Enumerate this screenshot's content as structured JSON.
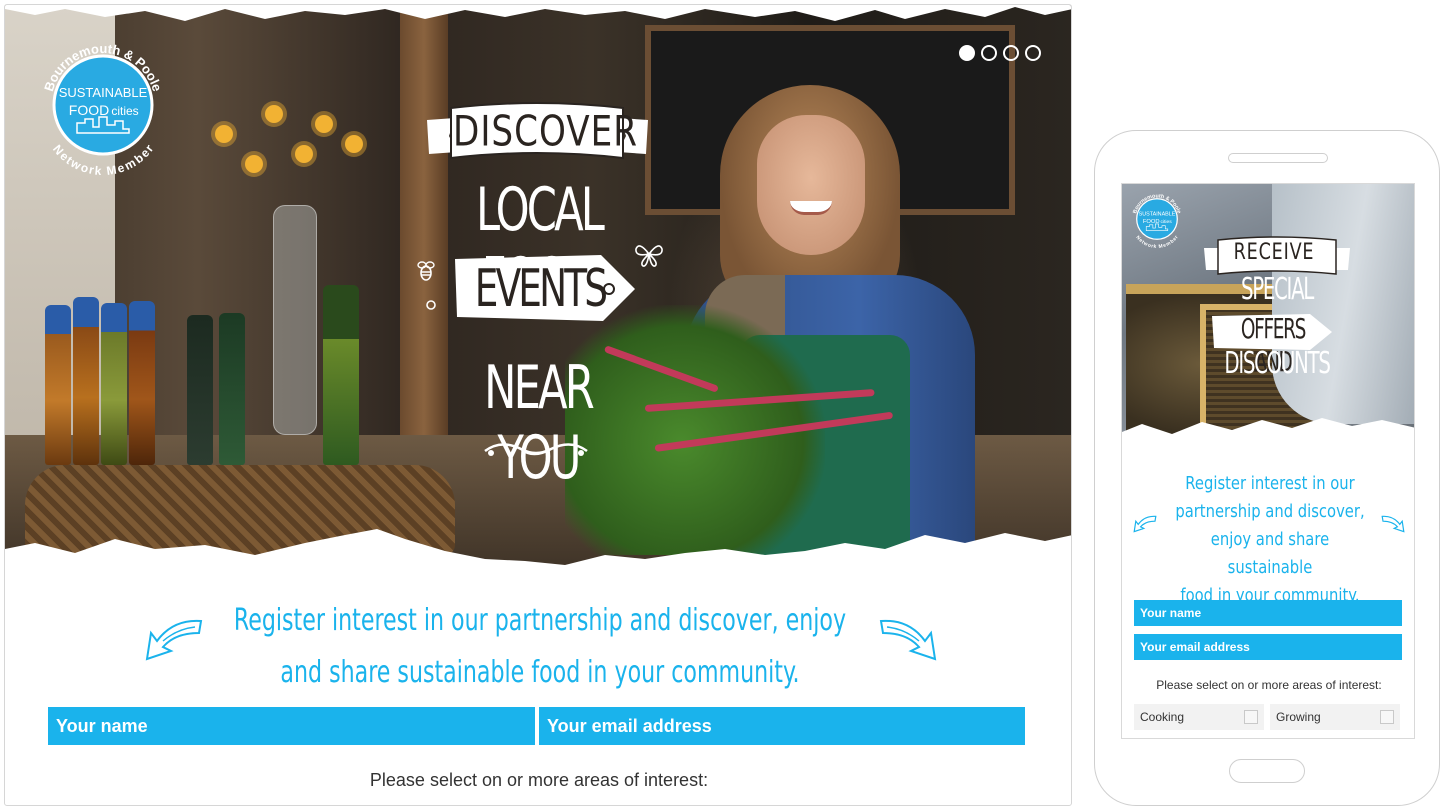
{
  "desktop": {
    "badge": {
      "top_text": "Bournemouth & Poole",
      "line1": "SUSTAINABLE",
      "line2": "FOOD",
      "line3": "cities",
      "bottom_text": "Network Member"
    },
    "hero": {
      "banner": "DISCOVER",
      "line1": "LOCAL FOOD",
      "tag": "EVENTS",
      "line2": "NEAR YOU"
    },
    "slider": {
      "count": 4,
      "active_index": 0
    },
    "tagline_line1": "Register interest in our partnership and discover, enjoy",
    "tagline_line2": "and share sustainable food in your community.",
    "form": {
      "name_placeholder": "Your name",
      "email_placeholder": "Your email address",
      "interest_label": "Please select on or more areas of interest:"
    }
  },
  "mobile": {
    "badge": {
      "top_text": "Bournemouth & Poole",
      "line1": "SUSTAINABLE",
      "line2": "FOOD",
      "line3": "cities",
      "bottom_text": "Network Member"
    },
    "hero": {
      "banner": "RECEIVE",
      "line1": "SPECIAL",
      "tag": "OFFERS AND",
      "line2": "DISCOUNTS"
    },
    "tagline_lines": [
      "Register interest in our",
      "partnership and discover,",
      "enjoy and share sustainable",
      "food in your community."
    ],
    "form": {
      "name_placeholder": "Your name",
      "email_placeholder": "Your email address",
      "interest_label": "Please select on or more areas of interest:",
      "interests": [
        "Cooking",
        "Growing"
      ]
    }
  },
  "colors": {
    "accent": "#1ab3ec",
    "badge_blue": "#29aae2",
    "text_dark": "#333333"
  }
}
